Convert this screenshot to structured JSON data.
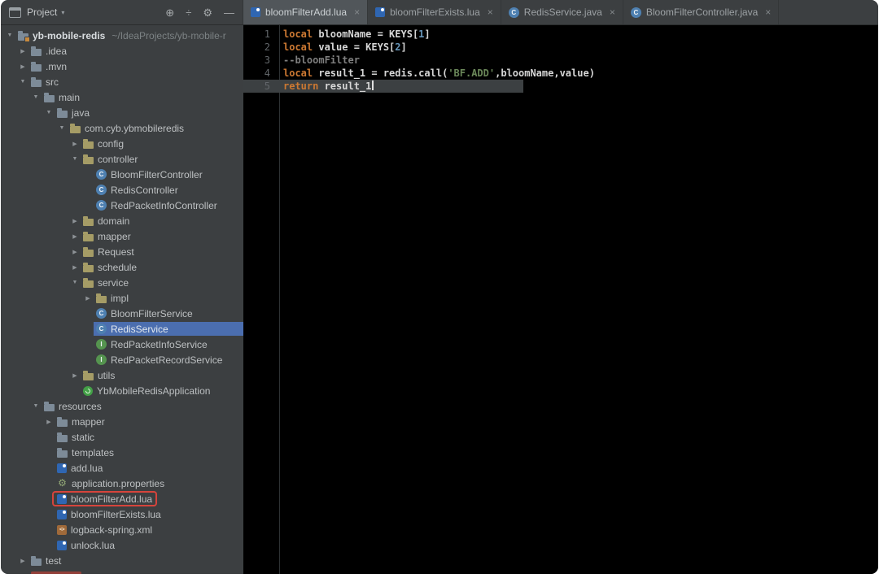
{
  "colors": {
    "panel_bg": "#3c3f41",
    "editor_bg": "#000000",
    "tree_selection": "#4b6eaf",
    "annotation_red": "#d6443c",
    "keyword": "#cc7832",
    "string": "#6a8759",
    "number": "#6897bb",
    "comment": "#7f7f7f",
    "active_tab_bg": "#51565a"
  },
  "toolbar": {
    "project_label": "Project",
    "dropdown_glyph": "▾",
    "icons": [
      {
        "name": "locate",
        "glyph": "⊕"
      },
      {
        "name": "collapse-all",
        "glyph": "÷"
      },
      {
        "name": "settings",
        "glyph": "⚙"
      },
      {
        "name": "hide",
        "glyph": "—"
      }
    ]
  },
  "ui": {
    "close_glyph": "×",
    "arrow_open": "▼",
    "arrow_closed": "▶",
    "class_glyph": "C",
    "interface_glyph": "I",
    "xml_glyph": "<>",
    "gear_glyph": "⚙"
  },
  "tabs": [
    {
      "label": "bloomFilterAdd.lua",
      "icon": "lua",
      "active": true
    },
    {
      "label": "bloomFilterExists.lua",
      "icon": "lua",
      "active": false
    },
    {
      "label": "RedisService.java",
      "icon": "class",
      "active": false
    },
    {
      "label": "BloomFilterController.java",
      "icon": "class",
      "active": false
    }
  ],
  "tree": {
    "items": [
      {
        "label": "yb-mobile-redis",
        "suffix": "~/IdeaProjects/yb-mobile-r",
        "indent": 0,
        "arrow": "open",
        "icon": "project",
        "bold": true
      },
      {
        "label": ".idea",
        "indent": 1,
        "arrow": "closed",
        "icon": "folder"
      },
      {
        "label": ".mvn",
        "indent": 1,
        "arrow": "closed",
        "icon": "folder"
      },
      {
        "label": "src",
        "indent": 1,
        "arrow": "open",
        "icon": "folder"
      },
      {
        "label": "main",
        "indent": 2,
        "arrow": "open",
        "icon": "folder"
      },
      {
        "label": "java",
        "indent": 3,
        "arrow": "open",
        "icon": "folder"
      },
      {
        "label": "com.cyb.ybmobileredis",
        "indent": 4,
        "arrow": "open",
        "icon": "folder-pkg"
      },
      {
        "label": "config",
        "indent": 5,
        "arrow": "closed",
        "icon": "folder-pkg"
      },
      {
        "label": "controller",
        "indent": 5,
        "arrow": "open",
        "icon": "folder-pkg"
      },
      {
        "label": "BloomFilterController",
        "indent": 6,
        "arrow": "none",
        "icon": "class"
      },
      {
        "label": "RedisController",
        "indent": 6,
        "arrow": "none",
        "icon": "class"
      },
      {
        "label": "RedPacketInfoController",
        "indent": 6,
        "arrow": "none",
        "icon": "class"
      },
      {
        "label": "domain",
        "indent": 5,
        "arrow": "closed",
        "icon": "folder-pkg"
      },
      {
        "label": "mapper",
        "indent": 5,
        "arrow": "closed",
        "icon": "folder-pkg"
      },
      {
        "label": "Request",
        "indent": 5,
        "arrow": "closed",
        "icon": "folder-pkg"
      },
      {
        "label": "schedule",
        "indent": 5,
        "arrow": "closed",
        "icon": "folder-pkg"
      },
      {
        "label": "service",
        "indent": 5,
        "arrow": "open",
        "icon": "folder-pkg"
      },
      {
        "label": "impl",
        "indent": 6,
        "arrow": "closed",
        "icon": "folder-pkg"
      },
      {
        "label": "BloomFilterService",
        "indent": 6,
        "arrow": "none",
        "icon": "class"
      },
      {
        "label": "RedisService",
        "indent": 6,
        "arrow": "none",
        "icon": "class",
        "selected": true
      },
      {
        "label": "RedPacketInfoService",
        "indent": 6,
        "arrow": "none",
        "icon": "interface"
      },
      {
        "label": "RedPacketRecordService",
        "indent": 6,
        "arrow": "none",
        "icon": "interface"
      },
      {
        "label": "utils",
        "indent": 5,
        "arrow": "closed",
        "icon": "folder-pkg"
      },
      {
        "label": "YbMobileRedisApplication",
        "indent": 5,
        "arrow": "none",
        "icon": "spring"
      },
      {
        "label": "resources",
        "indent": 2,
        "arrow": "open",
        "icon": "folder"
      },
      {
        "label": "mapper",
        "indent": 3,
        "arrow": "closed",
        "icon": "folder"
      },
      {
        "label": "static",
        "indent": 3,
        "arrow": "none",
        "icon": "folder"
      },
      {
        "label": "templates",
        "indent": 3,
        "arrow": "none",
        "icon": "folder"
      },
      {
        "label": "add.lua",
        "indent": 3,
        "arrow": "none",
        "icon": "lua"
      },
      {
        "label": "application.properties",
        "indent": 3,
        "arrow": "none",
        "icon": "props"
      },
      {
        "label": "bloomFilterAdd.lua",
        "indent": 3,
        "arrow": "none",
        "icon": "lua",
        "boxed": true
      },
      {
        "label": "bloomFilterExists.lua",
        "indent": 3,
        "arrow": "none",
        "icon": "lua"
      },
      {
        "label": "logback-spring.xml",
        "indent": 3,
        "arrow": "none",
        "icon": "xml"
      },
      {
        "label": "unlock.lua",
        "indent": 3,
        "arrow": "none",
        "icon": "lua"
      },
      {
        "label": "test",
        "indent": 1,
        "arrow": "closed",
        "icon": "folder"
      },
      {
        "label": "",
        "indent": 1,
        "arrow": "none",
        "icon": "folder",
        "red_blob": true
      }
    ]
  },
  "editor": {
    "lines": [
      {
        "num": "1",
        "segments": [
          {
            "c": "kw",
            "t": "local"
          },
          {
            "c": "id",
            "t": " bloomName = KEYS["
          },
          {
            "c": "num",
            "t": "1"
          },
          {
            "c": "id",
            "t": "]"
          }
        ]
      },
      {
        "num": "2",
        "segments": [
          {
            "c": "kw",
            "t": "local"
          },
          {
            "c": "id",
            "t": " value = KEYS["
          },
          {
            "c": "num",
            "t": "2"
          },
          {
            "c": "id",
            "t": "]"
          }
        ]
      },
      {
        "num": "3",
        "segments": [
          {
            "c": "com",
            "t": "--bloomFilter"
          }
        ]
      },
      {
        "num": "4",
        "segments": [
          {
            "c": "kw",
            "t": "local"
          },
          {
            "c": "id",
            "t": " result_1 = redis."
          },
          {
            "c": "fn",
            "t": "call"
          },
          {
            "c": "id",
            "t": "("
          },
          {
            "c": "str",
            "t": "'BF.ADD'"
          },
          {
            "c": "id",
            "t": ",bloomName,value)"
          }
        ]
      },
      {
        "num": "5",
        "current": true,
        "cursor": true,
        "segments": [
          {
            "c": "kw",
            "t": "return"
          },
          {
            "c": "id",
            "t": " result_1"
          }
        ]
      }
    ]
  }
}
